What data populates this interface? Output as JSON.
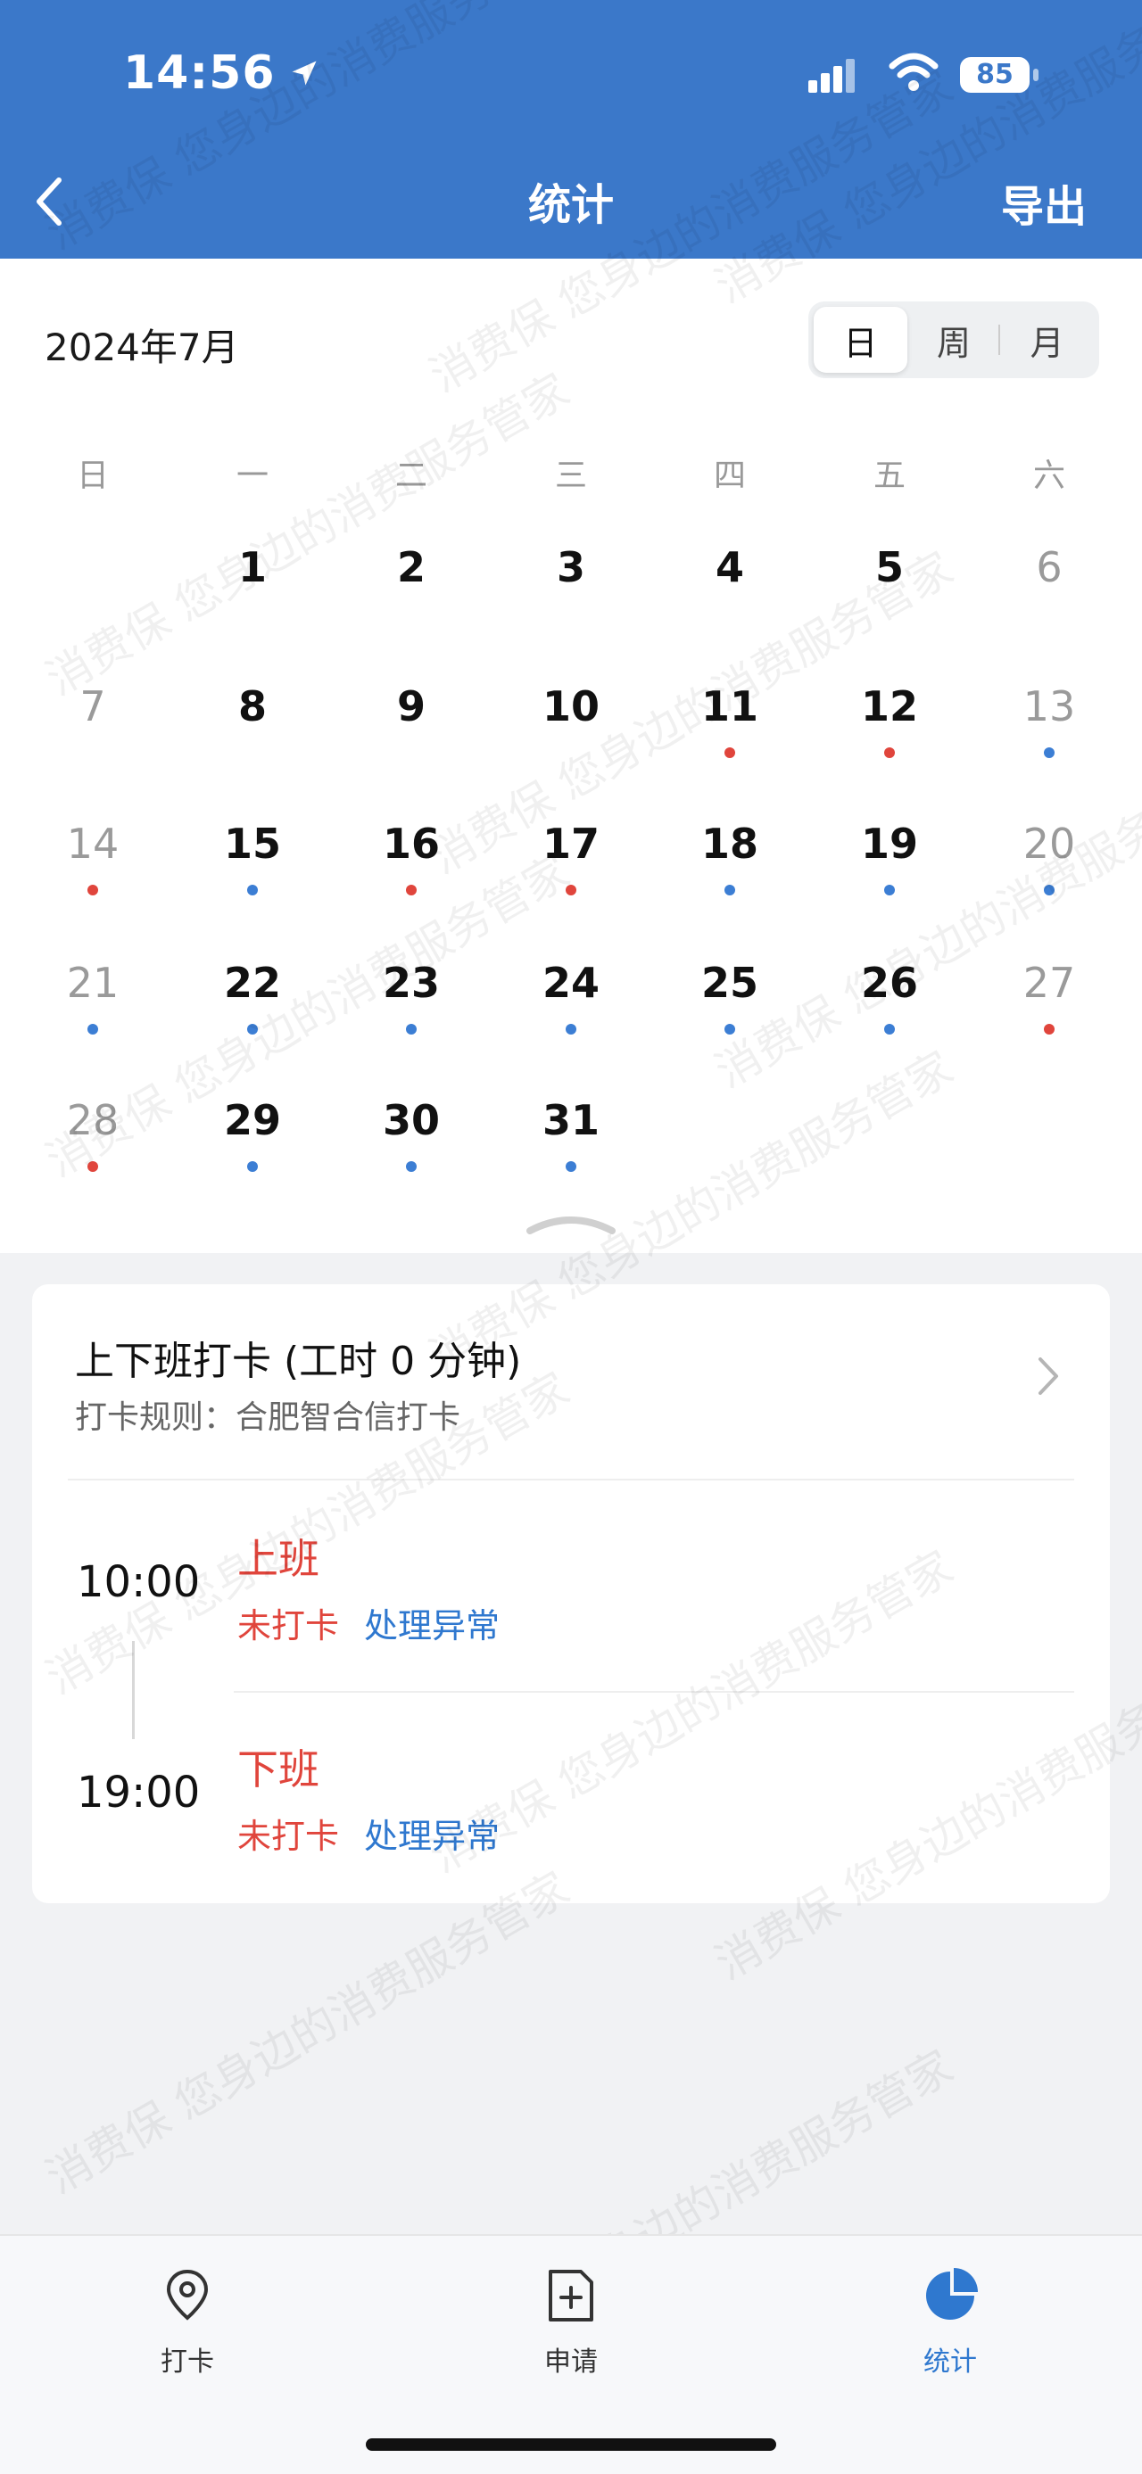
{
  "status_bar": {
    "time": "14:56",
    "battery": "85"
  },
  "header": {
    "title": "统计",
    "export_label": "导出"
  },
  "calendar": {
    "month_label": "2024年7月",
    "view_options": [
      "日",
      "周",
      "月"
    ],
    "selected_view": "日",
    "weekdays": [
      "日",
      "一",
      "二",
      "三",
      "四",
      "五",
      "六"
    ],
    "days": [
      "1",
      "2",
      "3",
      "4",
      "5",
      "6",
      "7",
      "8",
      "9",
      "10",
      "11",
      "12",
      "13",
      "14",
      "15",
      "16",
      "17",
      "18",
      "19",
      "20",
      "21",
      "22",
      "23",
      "24",
      "25",
      "26",
      "27",
      "28",
      "29",
      "30",
      "31"
    ],
    "day_marks": {
      "11": "red",
      "12": "red",
      "13": "blue",
      "14": "red",
      "15": "blue",
      "16": "red",
      "17": "red",
      "18": "blue",
      "19": "blue",
      "20": "blue",
      "21": "blue",
      "22": "blue",
      "23": "blue",
      "24": "blue",
      "25": "blue",
      "26": "blue",
      "27": "red",
      "28": "red",
      "29": "blue",
      "30": "blue",
      "31": "blue"
    },
    "mark_colors": {
      "red": "#e0453c",
      "blue": "#3c7ed4"
    }
  },
  "attendance": {
    "title": "上下班打卡 (工时 0 分钟)",
    "rule_label": "打卡规则：合肥智合信打卡",
    "entries": [
      {
        "time": "10:00",
        "shift": "上班",
        "status": "未打卡",
        "action": "处理异常"
      },
      {
        "time": "19:00",
        "shift": "下班",
        "status": "未打卡",
        "action": "处理异常"
      }
    ]
  },
  "tabs": [
    {
      "label": "打卡",
      "icon": "location-pin-icon"
    },
    {
      "label": "申请",
      "icon": "add-document-icon"
    },
    {
      "label": "统计",
      "icon": "pie-chart-icon",
      "active": true
    }
  ],
  "watermark": "消费保 您身边的消费服务管家",
  "colors": {
    "primary": "#3b78c9",
    "alert": "#e0453c",
    "link": "#2f78cf"
  }
}
